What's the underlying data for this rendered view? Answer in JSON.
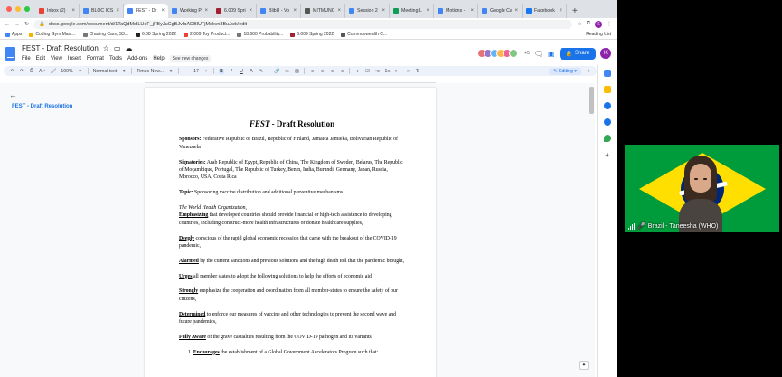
{
  "browser": {
    "tabs": [
      {
        "label": "Inbox (2)",
        "color": "#ea4335",
        "active": false
      },
      {
        "label": "BLOC ICS",
        "color": "#4285f4",
        "active": false
      },
      {
        "label": "FEST - Dr",
        "color": "#4285f4",
        "active": true
      },
      {
        "label": "Working P",
        "color": "#4285f4",
        "active": false
      },
      {
        "label": "6.009 Spri",
        "color": "#a31f34",
        "active": false
      },
      {
        "label": "BlibU - Vo",
        "color": "#4285f4",
        "active": false
      },
      {
        "label": "MITMUNC",
        "color": "#555555",
        "active": false
      },
      {
        "label": "Session 2",
        "color": "#4285f4",
        "active": false
      },
      {
        "label": "Meeting L",
        "color": "#0f9d58",
        "active": false
      },
      {
        "label": "Motions -",
        "color": "#4285f4",
        "active": false
      },
      {
        "label": "Google Ca",
        "color": "#4285f4",
        "active": false
      },
      {
        "label": "Facebook",
        "color": "#1877f2",
        "active": false
      }
    ],
    "new_tab": "+",
    "url": "docs.google.com/document/d/1TaQdMdjLUeF_jFByJuCgBJvIoADBlUTjMskvn3BuJwk/edit",
    "profile_initial": "K",
    "bookmarks": [
      {
        "label": "Apps",
        "color": "#4285f4"
      },
      {
        "label": "Coding Gym Mast...",
        "color": "#f4b400"
      },
      {
        "label": "Chasing Cars, S3...",
        "color": "#777777"
      },
      {
        "label": "6.08 Spring 2022",
        "color": "#222222"
      },
      {
        "label": "2.009 Toy Product...",
        "color": "#ea4335"
      },
      {
        "label": "18.600 Probability...",
        "color": "#777777"
      },
      {
        "label": "6.009 Spring 2022",
        "color": "#a31f34"
      },
      {
        "label": "Commonwealth C...",
        "color": "#555555"
      }
    ],
    "reading_list": "Reading List"
  },
  "docs": {
    "title": "FEST - Draft Resolution",
    "menus": [
      "File",
      "Edit",
      "View",
      "Insert",
      "Format",
      "Tools",
      "Add-ons",
      "Help"
    ],
    "changes_badge": "See new changes",
    "collaborators": [
      "#e57373",
      "#9575cd",
      "#64b5f6",
      "#ffb74d",
      "#f06292",
      "#81c784"
    ],
    "collaborator_count": "+5",
    "share_label": "Share",
    "user_initial": "K",
    "toolbar": {
      "zoom": "100%",
      "style": "Normal text",
      "font": "Times New...",
      "font_size": "17",
      "mode": "Editing"
    },
    "outline_item": "FEST - Draft Resolution"
  },
  "document": {
    "title_italic": "FEST",
    "title_rest": " - Draft Resolution",
    "sponsors_label": "Sponsors:",
    "sponsors": " Federative Republic of Brazil, Republic of Finland, Jamaica Jamieka, Bolivarian Republic of Venezuela",
    "signatories_label": "Signatories:",
    "signatories": " Arab Republic of Egypt, Republic of China, The Kingdom of Sweden, Belarus, The Republic of Moçambique, Portugal, The Republic of Turkey, Benin, India, Burundi, Germany, Japan, Russia, Morocco, USA, Costa Rica",
    "topic_label": "Topic:",
    "topic": " Sponsoring vaccine distribution and additional preventive mechanisms",
    "org": "The World Health Organization,",
    "clauses": [
      {
        "lead": "Emphasizing",
        "text": " that developed countries should provide financial or high-tech assistance to developing countries, including construct-more health infrastructures or donate healthcare supplies,"
      },
      {
        "lead": "Deeply",
        "text": " conscious of the rapid global economic recession that came with the breakout of the COVID-19 pandemic,"
      },
      {
        "lead": "Alarmed",
        "text": " by the current sanctions and previous solutions and the high death toll that the pandemic brought,"
      },
      {
        "lead": "Urges",
        "text": " all member states to adopt the following solutions to help the efforts of economic aid,"
      },
      {
        "lead": "Strongly",
        "text": " emphasize the cooperation and coordination from all member-states to ensure the safety of our citizens,"
      },
      {
        "lead": "Determined",
        "text": " to enforce our measures of vaccine and other technologies to prevent the second wave and future pandemics,"
      },
      {
        "lead": "Fully Aware",
        "text": " of the grave casualties resulting from the COVID-19 pathogen and its variants,"
      }
    ],
    "numbered": {
      "num": "1.",
      "lead": "Encourages",
      "text": " the establishment of a Global Government Accelerators Program such that:"
    }
  },
  "video": {
    "participant": "Brazil - Taneesha (WHO)"
  }
}
